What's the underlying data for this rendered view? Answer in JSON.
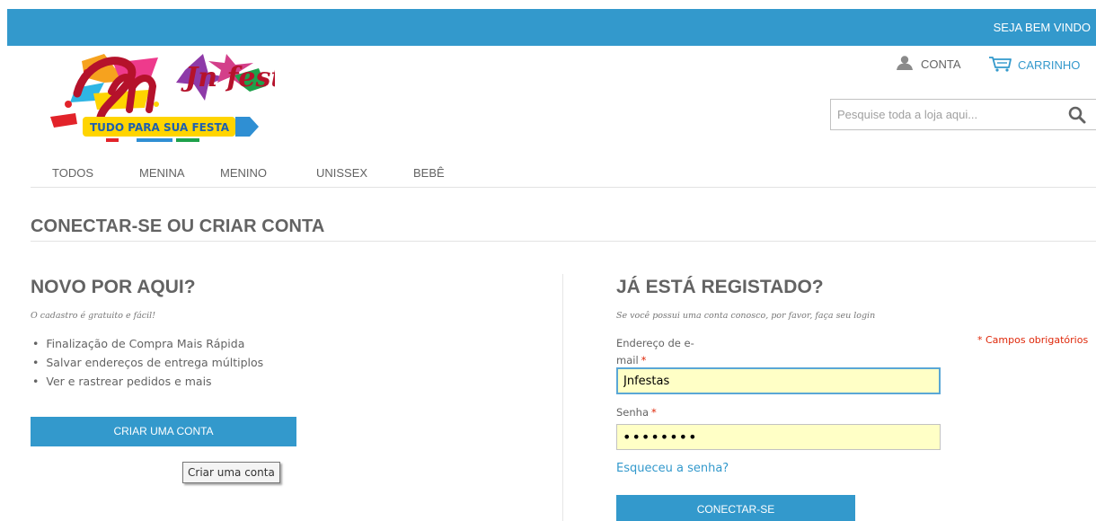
{
  "topbar": {
    "welcome": "SEJA BEM VINDO"
  },
  "header": {
    "logo_brand": "Jn festas",
    "logo_tagline": "TUDO PARA SUA FESTA",
    "account_label": "CONTA",
    "cart_label": "CARRINHO",
    "search_placeholder": "Pesquise toda a loja aqui..."
  },
  "nav": {
    "items": [
      "TODOS",
      "MENINA",
      "MENINO",
      "UNISSEX",
      "BEBÊ"
    ]
  },
  "page": {
    "title": "CONECTAR-SE OU CRIAR CONTA"
  },
  "new_customer": {
    "heading": "NOVO POR AQUI?",
    "subtitle": "O cadastro é gratuito e fácil!",
    "benefits": [
      "Finalização de Compra Mais Rápida",
      "Salvar endereços de entrega múltiplos",
      "Ver e rastrear pedidos e mais"
    ],
    "button_label": "CRIAR UMA CONTA",
    "tooltip": "Criar uma conta"
  },
  "login": {
    "heading": "JÁ ESTÁ REGISTADO?",
    "subtitle": "Se você possui uma conta conosco, por favor, faça seu login",
    "email_label_line1": "Endereço de e-",
    "email_label_line2": "mail",
    "required_star": "*",
    "email_value": "Jnfestas",
    "password_label": "Senha",
    "password_value": "••••••••",
    "required_note": "* Campos obrigatórios",
    "forgot_link": "Esqueceu a senha?",
    "button_label": "CONECTAR-SE"
  },
  "colors": {
    "accent": "#3399cc",
    "required": "#df280a",
    "autofill": "#ffffc6"
  },
  "icons": {
    "account": "user-icon",
    "cart": "cart-icon",
    "search": "search-icon"
  }
}
